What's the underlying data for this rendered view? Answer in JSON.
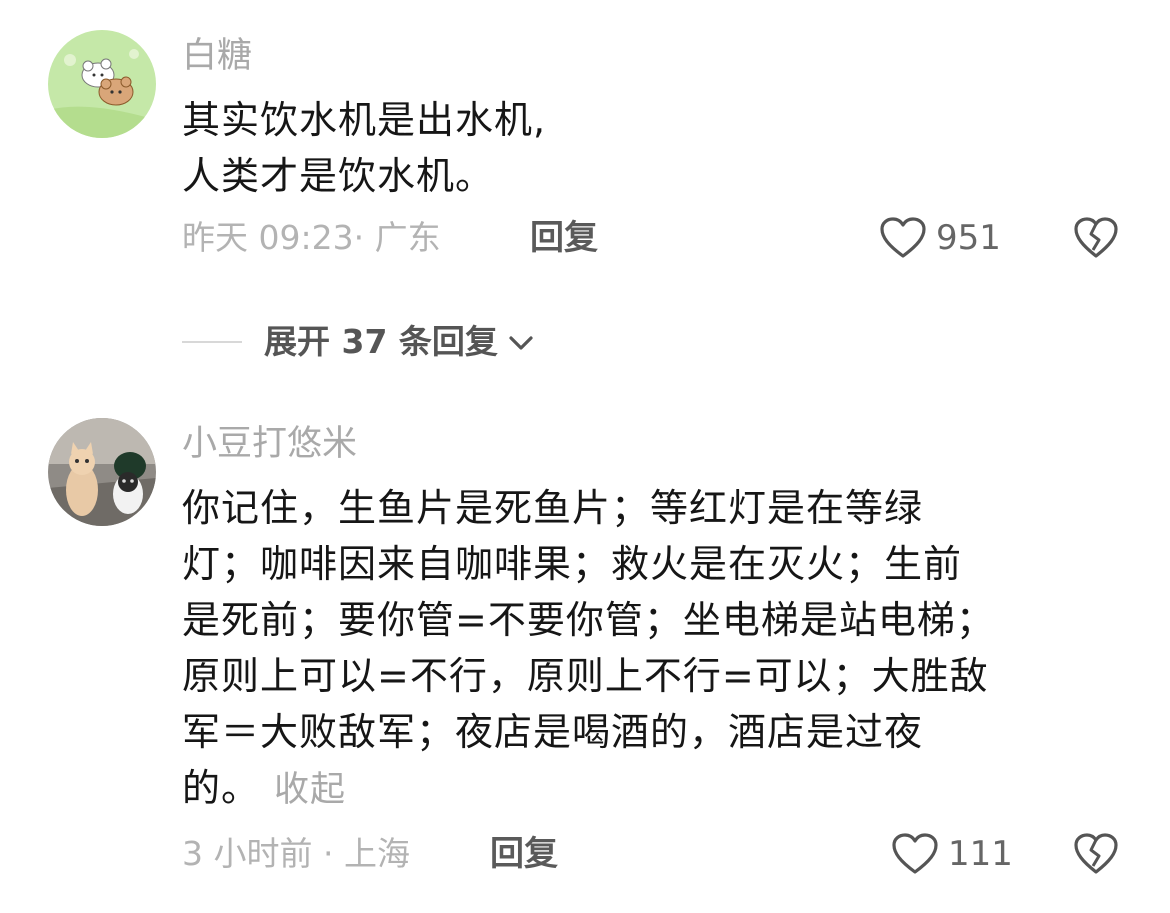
{
  "comments": [
    {
      "username": "白糖",
      "lines": [
        "其实饮水机是出水机,",
        "人类才是饮水机。"
      ],
      "meta": "昨天 09:23· 广东",
      "reply_label": "回复",
      "like_count": "951",
      "avatar_icon": "cartoon-bears-avatar"
    },
    {
      "username": "小豆打悠米",
      "lines": [
        "你记住，生鱼片是死鱼片；等红灯是在等绿",
        "灯；咖啡因来自咖啡果；救火是在灭火；生前",
        "是死前；要你管=不要你管；坐电梯是站电梯；",
        "原则上可以=不行，原则上不行=可以；大胜敌",
        "军＝大败敌军；夜店是喝酒的，酒店是过夜",
        "的。"
      ],
      "collapse_label": "收起",
      "meta": "3 小时前 · 上海",
      "reply_label": "回复",
      "like_count": "111",
      "avatar_icon": "cats-photo-avatar"
    }
  ],
  "expand_replies": {
    "label": "展开 37 条回复",
    "icon": "chevron-down-icon"
  },
  "icons": {
    "like": "heart-outline-icon",
    "dislike": "broken-heart-icon"
  },
  "colors": {
    "text": "#161616",
    "muted": "#a9a9a9",
    "icon": "#555555"
  }
}
